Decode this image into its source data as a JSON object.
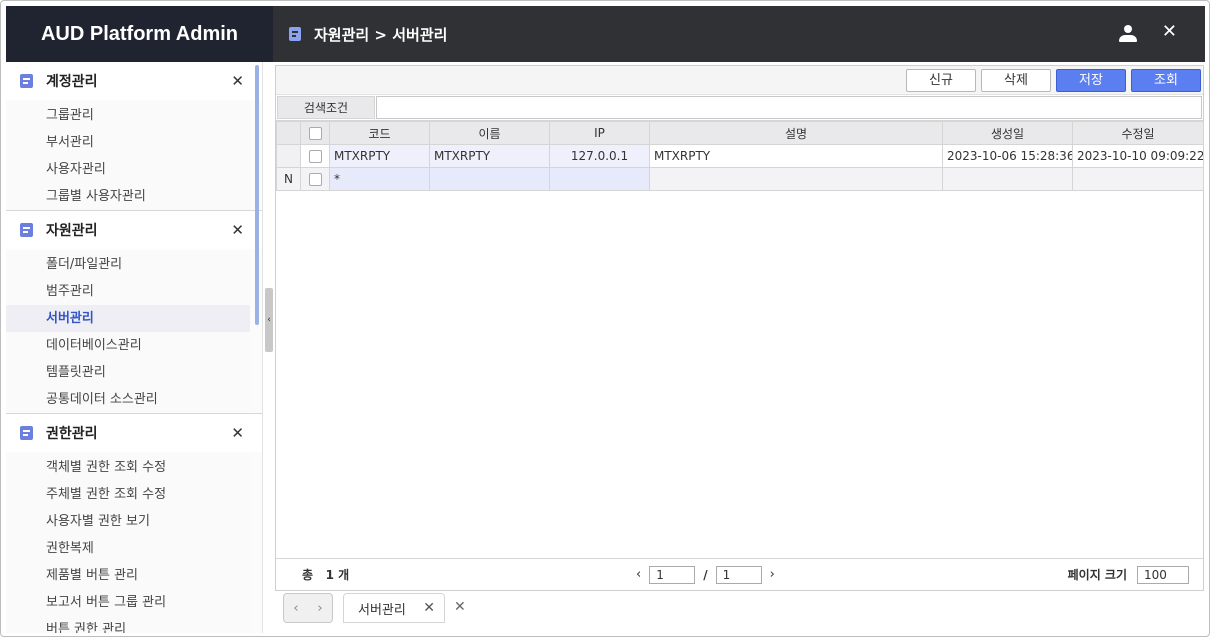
{
  "app": {
    "title": "AUD Platform Admin"
  },
  "header": {
    "breadcrumb": "자원관리 > 서버관리"
  },
  "sidebar": {
    "groups": [
      {
        "title": "계정관리",
        "items": [
          "그룹관리",
          "부서관리",
          "사용자관리",
          "그룹별 사용자관리"
        ]
      },
      {
        "title": "자원관리",
        "items": [
          "폴더/파일관리",
          "범주관리",
          "서버관리",
          "데이터베이스관리",
          "템플릿관리",
          "공통데이터 소스관리"
        ]
      },
      {
        "title": "권한관리",
        "items": [
          "객체별 권한 조회 수정",
          "주체별 권한 조회 수정",
          "사용자별 권한 보기",
          "권한복제",
          "제품별 버튼 관리",
          "보고서 버튼 그룹 관리",
          "버튼 권한 관리"
        ]
      }
    ],
    "active_item": "서버관리"
  },
  "toolbar": {
    "new_label": "신규",
    "delete_label": "삭제",
    "save_label": "저장",
    "query_label": "조회"
  },
  "search": {
    "label": "검색조건",
    "value": ""
  },
  "grid": {
    "columns": [
      "코드",
      "이름",
      "IP",
      "설명",
      "생성일",
      "수정일"
    ],
    "rows": [
      {
        "code": "MTXRPTY",
        "name": "MTXRPTY",
        "ip": "127.0.0.1",
        "desc": "MTXRPTY",
        "created": "2023-10-06 15:28:36...",
        "modified": "2023-10-10 09:09:22..."
      }
    ],
    "new_row": {
      "marker": "N",
      "code": "*"
    }
  },
  "footer": {
    "total_prefix": "총",
    "total_count": "1",
    "total_suffix": "개",
    "page_current": "1",
    "page_sep": "/",
    "page_total": "1",
    "page_size_label": "페이지 크기",
    "page_size": "100"
  },
  "tabs": {
    "items": [
      {
        "label": "서버관리"
      }
    ]
  },
  "colors": {
    "accent": "#5b7ef0",
    "header_bg": "#2f3134",
    "brand_bg": "#1f2430",
    "active_text": "#3155c9"
  }
}
